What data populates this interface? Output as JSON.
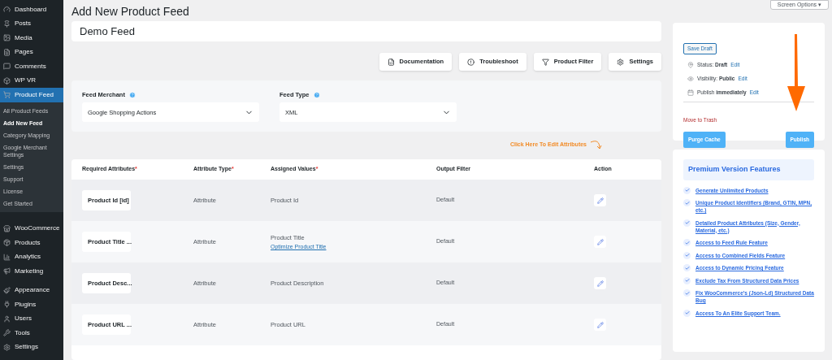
{
  "sidebar": {
    "items": [
      {
        "label": "Dashboard",
        "selected": false
      },
      {
        "label": "Posts",
        "selected": false
      },
      {
        "label": "Media",
        "selected": false
      },
      {
        "label": "Pages",
        "selected": false
      },
      {
        "label": "Comments",
        "selected": false
      },
      {
        "label": "WP VR",
        "selected": false
      },
      {
        "label": "Product Feed",
        "selected": true,
        "children": [
          {
            "label": "All Product Feeds",
            "selected": false
          },
          {
            "label": "Add New Feed",
            "selected": true
          },
          {
            "label": "Category Mapping",
            "selected": false
          },
          {
            "label": "Google Merchant Settings",
            "selected": false
          },
          {
            "label": "Settings",
            "selected": false
          },
          {
            "label": "Support",
            "selected": false
          },
          {
            "label": "License",
            "selected": false
          },
          {
            "label": "Get Started",
            "selected": false
          }
        ]
      },
      {
        "label": "WooCommerce",
        "selected": false
      },
      {
        "label": "Products",
        "selected": false
      },
      {
        "label": "Analytics",
        "selected": false
      },
      {
        "label": "Marketing",
        "selected": false
      },
      {
        "label": "Appearance",
        "selected": false
      },
      {
        "label": "Plugins",
        "selected": false
      },
      {
        "label": "Users",
        "selected": false
      },
      {
        "label": "Tools",
        "selected": false
      },
      {
        "label": "Settings",
        "selected": false
      }
    ]
  },
  "page_title": "Add New Product Feed",
  "screen_options": "Screen Options ▾",
  "feed_name": {
    "value": "Demo Feed"
  },
  "toolbar": [
    "Documentation",
    "Troubleshoot",
    "Product Filter",
    "Settings"
  ],
  "feed_merchant": {
    "label": "Feed Merchant",
    "value": "Google Shopping Actions"
  },
  "feed_type": {
    "label": "Feed Type",
    "value": "XML"
  },
  "hint": "Click Here To Edit Attributes",
  "table": {
    "columns": [
      {
        "label": "Required Attributes",
        "marker": "*"
      },
      {
        "label": "Attribute Type",
        "marker": "*"
      },
      {
        "label": "Assigned Values",
        "marker": "*"
      },
      {
        "label": "Output Filter"
      },
      {
        "label": "Action"
      }
    ],
    "rows": [
      {
        "attribute": "Product Id [id]",
        "type": "Attribute",
        "value": "Product Id",
        "filter": "Default"
      },
      {
        "attribute": "Product Title ...",
        "type": "Attribute",
        "value": "Product Title",
        "link": "Optimize Product Title",
        "filter": "Default"
      },
      {
        "attribute": "Product Desc...",
        "type": "Attribute",
        "value": "Product Description",
        "filter": "Default"
      },
      {
        "attribute": "Product URL ...",
        "type": "Attribute",
        "value": "Product URL",
        "filter": "Default"
      }
    ]
  },
  "publish": {
    "save_draft": "Save Draft",
    "meta": [
      {
        "text": "Status: **Draft**",
        "edit": "Edit"
      },
      {
        "text": "Visibility: **Public**",
        "edit": "Edit"
      },
      {
        "text": "Publish **immediately**",
        "edit": "Edit"
      }
    ],
    "trash": "Move to Trash",
    "purge": "Purge Cache",
    "publish": "Publish"
  },
  "premium": {
    "title": "Premium Version Features",
    "items": [
      "Generate Unlimited Products",
      "Unique Product Identifiers (Brand, GTIN, MPN, etc.)",
      "Detailed Product Attributes (Size, Gender, Material, etc.)",
      "Access to Feed Rule Feature",
      "Access to Combined Fields Feature",
      "Access to Dynamic Pricing Feature",
      "Exclude Tax From Structured Data Prices",
      "Fix WooCommerce's (Json-Ld) Structured Data Bug",
      "Access To An Elite Support Team."
    ]
  }
}
